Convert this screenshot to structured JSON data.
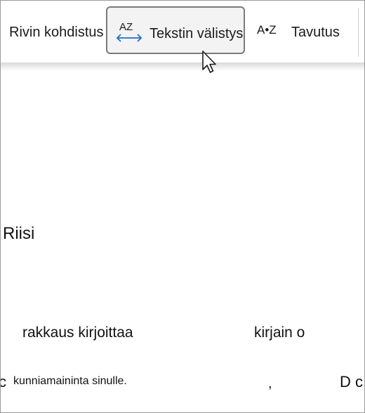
{
  "toolbar": {
    "line_alignment_label": "Rivin kohdistus",
    "text_spacing_label": "Tekstin välistys",
    "text_spacing_icon_text": "AZ",
    "hyphenation_label": "Tavutus",
    "hyphenation_icon_text": "A•Z",
    "accent_color": "#1e6fc5"
  },
  "document": {
    "word_rice": "Riisi",
    "phrase_love_write": "rakkaus kirjoittaa",
    "phrase_letter_o": "kirjain o",
    "fragment_left": "c",
    "phrase_honorable_mention": "kunniamaininta sinulle.",
    "fragment_comma": ",",
    "fragment_right": "D c"
  }
}
